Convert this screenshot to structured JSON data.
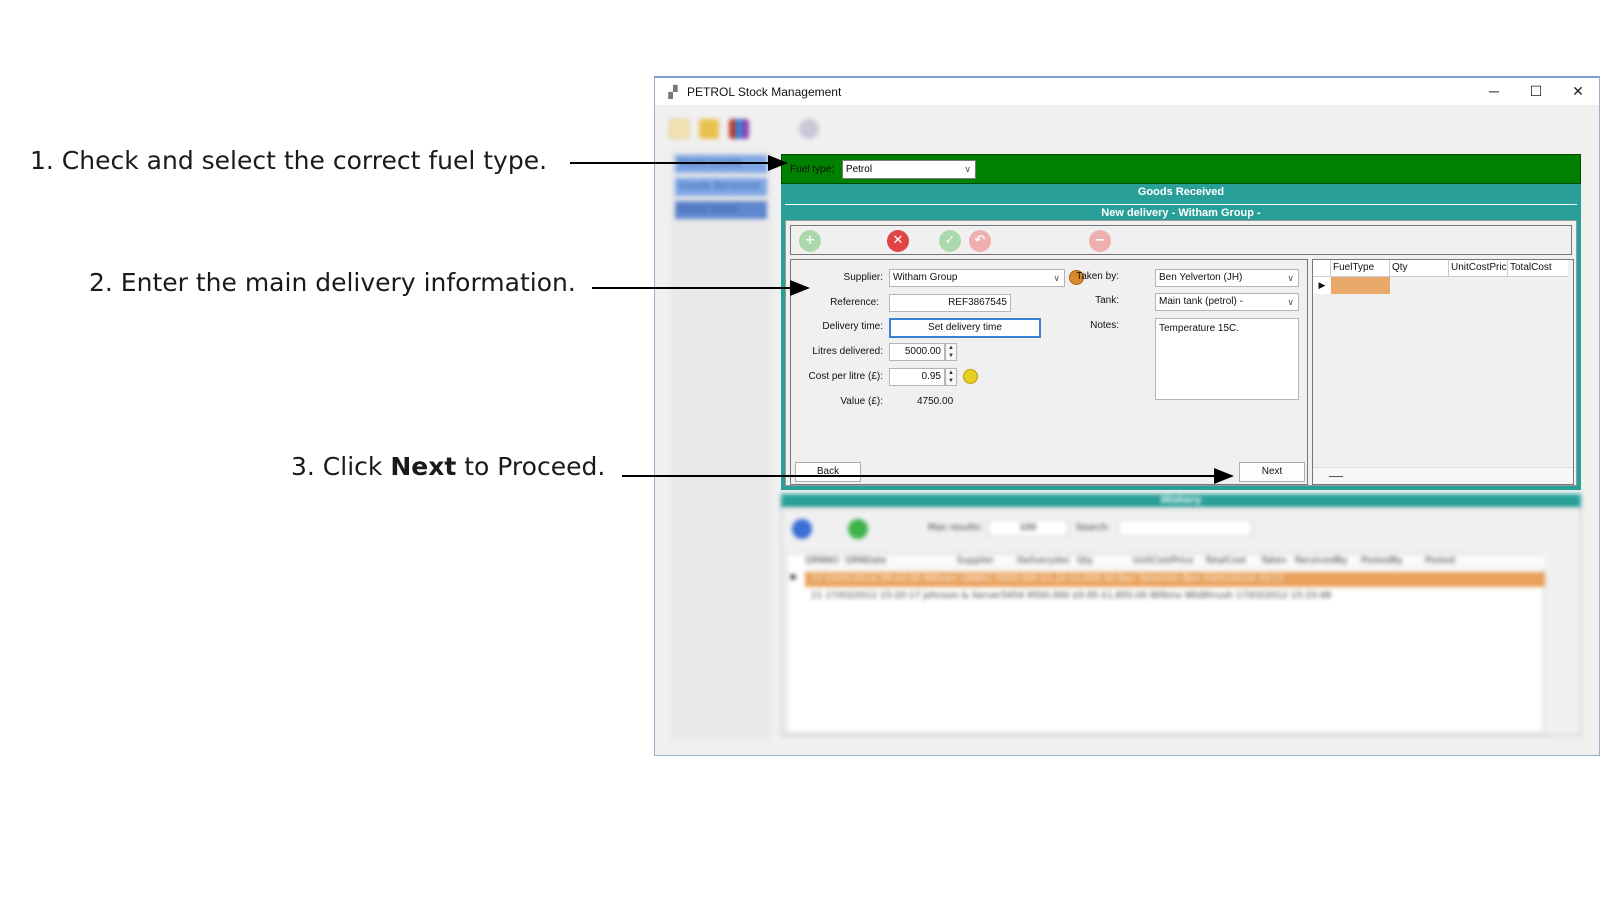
{
  "callouts": {
    "step1": "1. Check and select the correct fuel type.",
    "step2": "2. Enter the main delivery information.",
    "step3_prefix": "3. Click ",
    "step3_bold": "Next",
    "step3_suffix": " to Proceed."
  },
  "window": {
    "title": "PETROL Stock Management",
    "controls": {
      "minimize": "─",
      "maximize": "☐",
      "close": "✕"
    }
  },
  "sidebar": {
    "items": [
      "Stock Levels",
      "Goods Received",
      "Blend Stock"
    ]
  },
  "fuel": {
    "label": "Fuel type:",
    "value": "Petrol"
  },
  "goods_received": {
    "header": "Goods Received",
    "new_delivery_header": "New delivery - Witham Group -"
  },
  "form": {
    "supplier_label": "Supplier:",
    "supplier_value": "Witham Group",
    "reference_label": "Reference:",
    "reference_value": "REF3867545",
    "delivery_time_label": "Delivery time:",
    "delivery_time_button": "Set delivery time",
    "litres_label": "Litres delivered:",
    "litres_value": "5000.00",
    "cost_label": "Cost per litre (£):",
    "cost_value": "0.95",
    "value_label": "Value (£):",
    "value_value": "4750.00",
    "taken_by_label": "Taken by:",
    "taken_by_value": "Ben Yelverton (JH)",
    "tank_label": "Tank:",
    "tank_value": "Main tank (petrol) -",
    "notes_label": "Notes:",
    "notes_value": "Temperature 15C.",
    "back_button": "Back",
    "next_button": "Next"
  },
  "grid": {
    "columns": [
      "FuelType",
      "Qty",
      "UnitCostPric",
      "TotalCost"
    ]
  },
  "history": {
    "header": "History",
    "max_results_label": "Max results:",
    "max_results_value": "100",
    "search_label": "Search:",
    "columns": [
      "GRNNO",
      "GRNDate",
      "Supplier",
      "Deliverydoc",
      "Qty",
      "UnitCostPrice",
      "TotalCost",
      "Taken",
      "ReceivedBy",
      "PostedBy",
      "Posted"
    ],
    "rows": [
      "12  03/01/2014 09:43:00   Witham   GRN01   5000.000   £1.20   £1,000.00   Ben Yelverton Ben   03/01/2014 10:11",
      "11  17/03/2012 15:20:17   Johnson &   Server5454   9500.000   £0.95   £1,855.00   Wilkins   Wildthrush   17/03/2012 15:33:48"
    ]
  },
  "colors": {
    "fuel_bar": "#008000",
    "teal": "#28a099",
    "selected_row": "#e8a05a",
    "grid_cell": "#e8a96a"
  }
}
